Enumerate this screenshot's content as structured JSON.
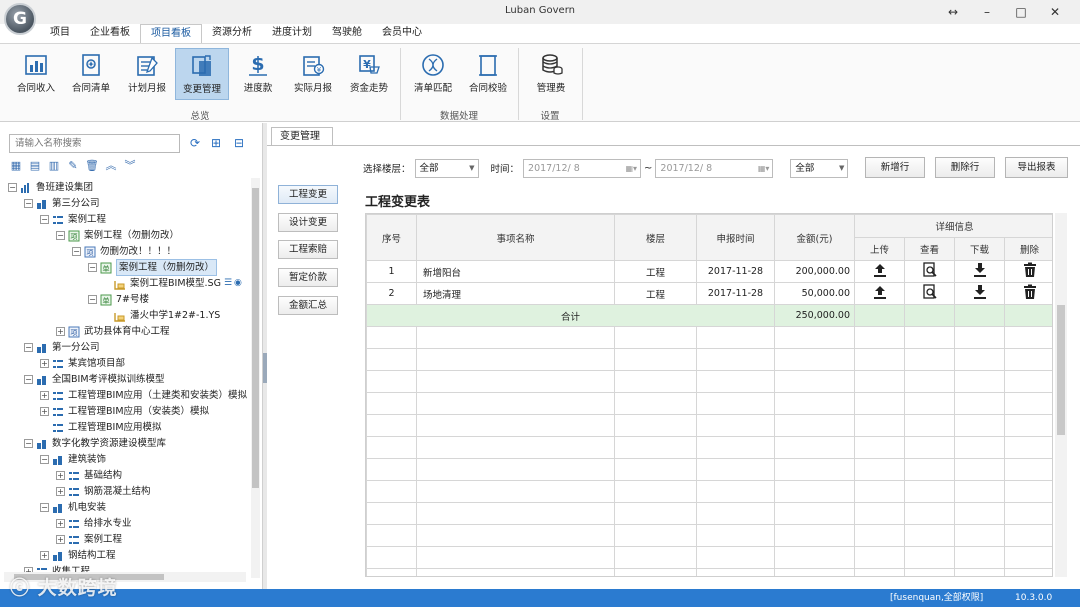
{
  "app": {
    "title": "Luban Govern",
    "logo_letter": "G"
  },
  "window": {
    "resize": "↔",
    "minimize": "–",
    "maximize": "□",
    "close": "✕"
  },
  "menu_tabs": [
    "项目",
    "企业看板",
    "项目看板",
    "资源分析",
    "进度计划",
    "驾驶舱",
    "会员中心"
  ],
  "ribbon": {
    "buttons": [
      {
        "label": "合同收入"
      },
      {
        "label": "合同清单"
      },
      {
        "label": "计划月报"
      },
      {
        "label": "变更管理"
      },
      {
        "label": "进度款"
      },
      {
        "label": "实际月报"
      },
      {
        "label": "资金走势"
      },
      {
        "label": "清单匹配"
      },
      {
        "label": "合同校验"
      },
      {
        "label": "管理费"
      }
    ],
    "groups": [
      "总览",
      "数据处理",
      "设置"
    ]
  },
  "sidebar": {
    "search_placeholder": "请输入名称搜索",
    "tree": [
      {
        "label": "鲁班建设集团"
      },
      {
        "label": "第三分公司"
      },
      {
        "label": "案例工程"
      },
      {
        "label": "案例工程（勿删勿改）"
      },
      {
        "label": "勿删勿改！！！！"
      },
      {
        "label": "案例工程（勿删勿改）"
      },
      {
        "label": "案例工程BIM模型.SG"
      },
      {
        "label": "7#号楼"
      },
      {
        "label": "潘火中学1#2#-1.YS"
      },
      {
        "label": "武功县体育中心工程"
      },
      {
        "label": "第一分公司"
      },
      {
        "label": "某宾馆项目部"
      },
      {
        "label": "全国BIM考评模拟训练模型"
      },
      {
        "label": "工程管理BIM应用（土建类和安装类）模拟"
      },
      {
        "label": "工程管理BIM应用（安装类）模拟"
      },
      {
        "label": "工程管理BIM应用模拟"
      },
      {
        "label": "数字化教学资源建设模型库"
      },
      {
        "label": "建筑装饰"
      },
      {
        "label": "基础结构"
      },
      {
        "label": "钢筋混凝土结构"
      },
      {
        "label": "机电安装"
      },
      {
        "label": "给排水专业"
      },
      {
        "label": "案例工程"
      },
      {
        "label": "钢结构工程"
      },
      {
        "label": "收集工程"
      }
    ]
  },
  "main": {
    "doc_tab": "变更管理",
    "filter": {
      "floor_label": "选择楼层：",
      "floor_value": "全部",
      "time_label": "时间：",
      "date_from": "2017/12/  8",
      "tilde": "~",
      "date_to": "2017/12/  8",
      "scope_value": "全部"
    },
    "buttons": {
      "add_row": "新增行",
      "delete_row": "删除行",
      "export": "导出报表"
    },
    "side_buttons": [
      "工程变更",
      "设计变更",
      "工程索赔",
      "暂定价款",
      "金额汇总"
    ],
    "table_title": "工程变更表",
    "columns": {
      "seq": "序号",
      "name": "事项名称",
      "floor": "楼层",
      "date": "申报时间",
      "amount": "金额(元)",
      "detail": "详细信息",
      "upload": "上传",
      "view": "查看",
      "download": "下载",
      "delete": "删除"
    },
    "rows": [
      {
        "seq": "1",
        "name": "新增阳台",
        "floor": "工程",
        "date": "2017-11-28",
        "amount": "200,000.00"
      },
      {
        "seq": "2",
        "name": "场地清理",
        "floor": "工程",
        "date": "2017-11-28",
        "amount": "50,000.00"
      }
    ],
    "total": {
      "label": "合计",
      "amount": "250,000.00"
    }
  },
  "status": {
    "user": "[fusenquan,全部权限]",
    "version": "10.3.0.0",
    "watermark": "大数跨境"
  }
}
